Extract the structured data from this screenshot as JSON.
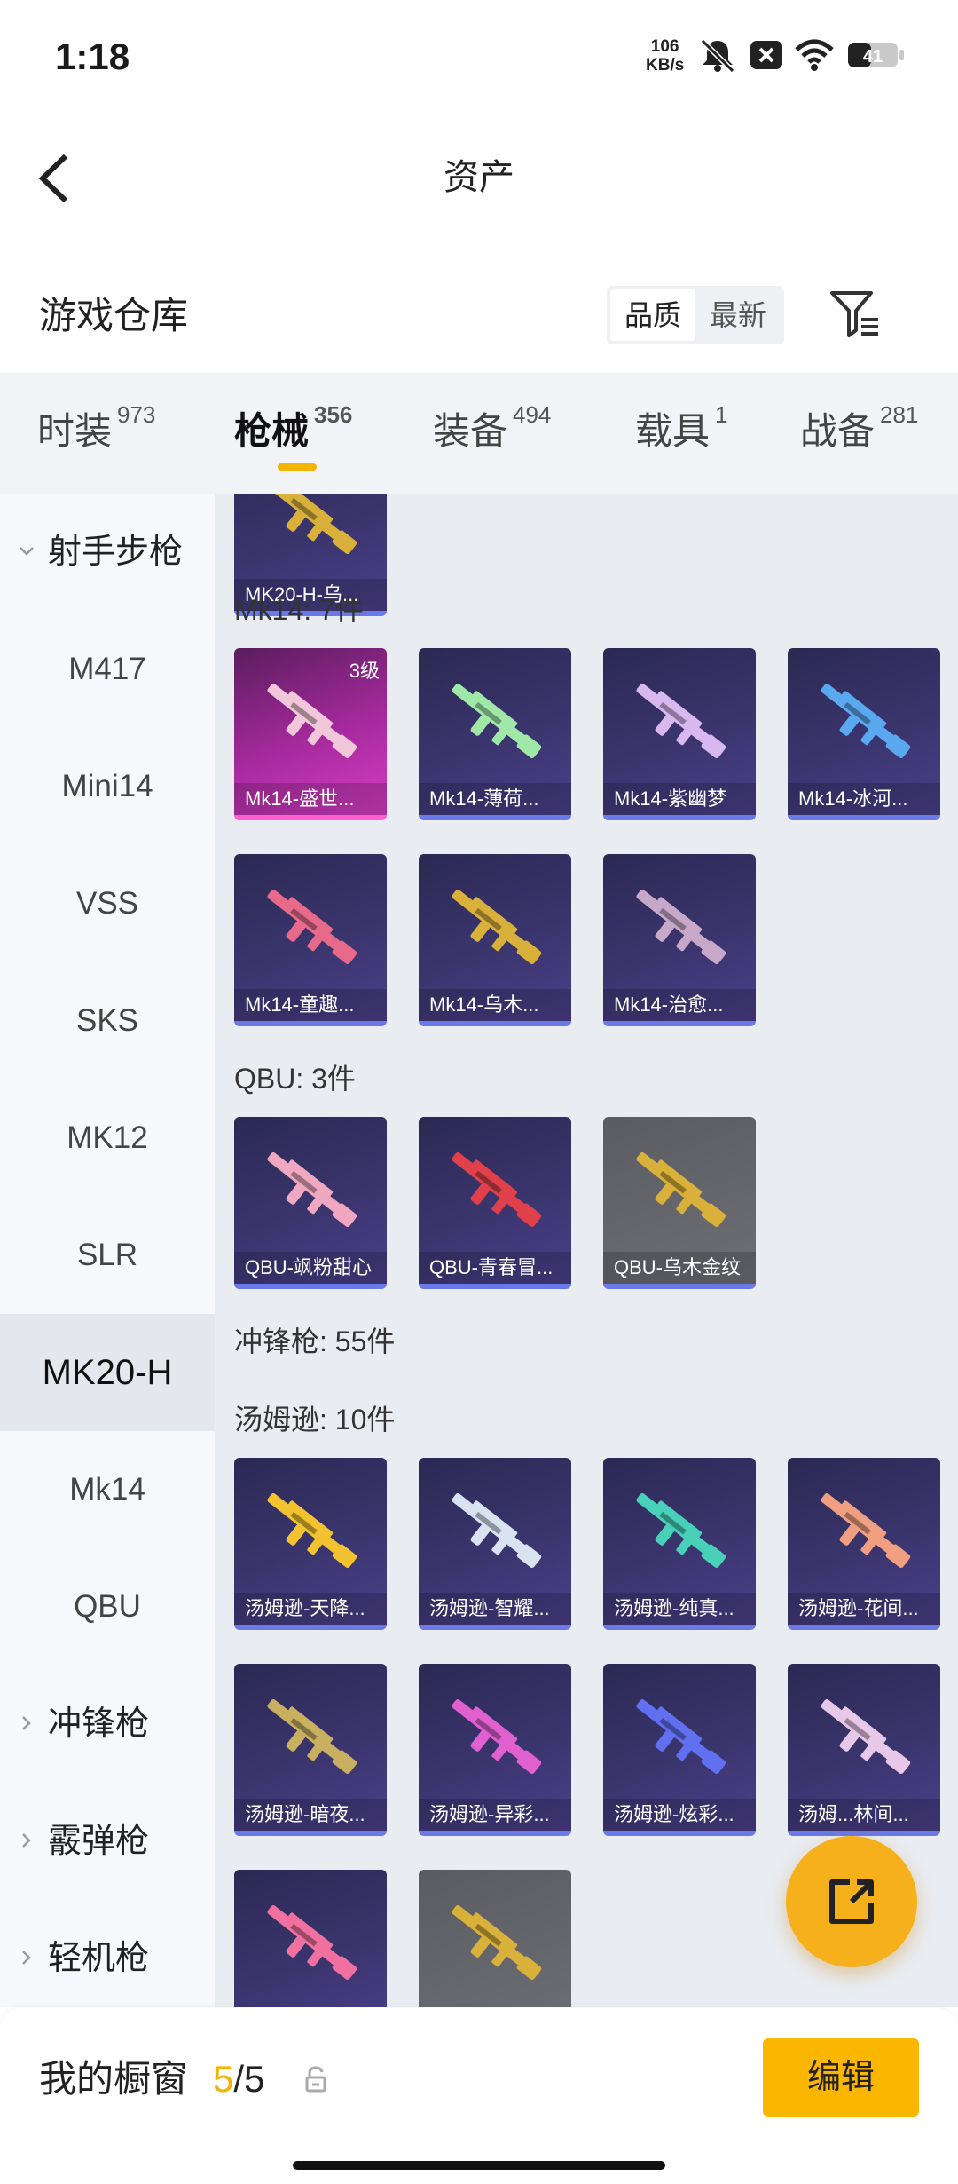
{
  "status_bar": {
    "time": "1:18",
    "net_speed_value": "106",
    "net_speed_unit": "KB/s",
    "battery": "41"
  },
  "nav": {
    "title": "资产"
  },
  "section": {
    "title": "游戏仓库",
    "sort_options": [
      "品质",
      "最新"
    ],
    "sort_selected": "品质"
  },
  "tabs": [
    {
      "label": "时装",
      "count": "973"
    },
    {
      "label": "枪械",
      "count": "356",
      "active": true
    },
    {
      "label": "装备",
      "count": "494"
    },
    {
      "label": "载具",
      "count": "1"
    },
    {
      "label": "战备",
      "count": "281"
    }
  ],
  "sidebar": [
    {
      "label": "射手步枪",
      "type": "group",
      "expanded": true
    },
    {
      "label": "M417"
    },
    {
      "label": "Mini14"
    },
    {
      "label": "VSS"
    },
    {
      "label": "SKS"
    },
    {
      "label": "MK12"
    },
    {
      "label": "SLR"
    },
    {
      "label": "MK20-H",
      "selected": true
    },
    {
      "label": "Mk14"
    },
    {
      "label": "QBU"
    },
    {
      "label": "冲锋枪",
      "type": "group",
      "expanded": false
    },
    {
      "label": "霰弹枪",
      "type": "group",
      "expanded": false
    },
    {
      "label": "轻机枪",
      "type": "group",
      "expanded": false
    }
  ],
  "content": {
    "top_partial_card": {
      "label": "MK20-H-乌...",
      "style": "blue"
    },
    "groups": [
      {
        "heading": "Mk14: 7件",
        "items": [
          {
            "label": "Mk14-盛世...",
            "style": "pink",
            "level": "3级",
            "gun_color": "#f2c7d9"
          },
          {
            "label": "Mk14-薄荷...",
            "style": "blue",
            "gun_color": "#9fe8a8"
          },
          {
            "label": "Mk14-紫幽梦",
            "style": "blue",
            "gun_color": "#d9b8f0"
          },
          {
            "label": "Mk14-冰河...",
            "style": "blue",
            "gun_color": "#5aa8f0"
          },
          {
            "label": "Mk14-童趣...",
            "style": "blue",
            "gun_color": "#e86a8a"
          },
          {
            "label": "Mk14-乌木...",
            "style": "blue",
            "gun_color": "#d9b13a"
          },
          {
            "label": "Mk14-治愈...",
            "style": "blue",
            "gun_color": "#c8a8c8"
          }
        ]
      },
      {
        "heading": "QBU: 3件",
        "items": [
          {
            "label": "QBU-飒粉甜心",
            "style": "blue",
            "gun_color": "#f0a8c0"
          },
          {
            "label": "QBU-青春冒...",
            "style": "blue",
            "gun_color": "#e0404a"
          },
          {
            "label": "QBU-乌木金纹",
            "style": "grey",
            "gun_color": "#d9b13a"
          }
        ]
      },
      {
        "heading": "冲锋枪: 55件",
        "items": []
      },
      {
        "heading": "汤姆逊: 10件",
        "items": [
          {
            "label": "汤姆逊-天降...",
            "style": "blue",
            "gun_color": "#f2c230"
          },
          {
            "label": "汤姆逊-智耀...",
            "style": "blue",
            "gun_color": "#d8e2f0"
          },
          {
            "label": "汤姆逊-纯真...",
            "style": "blue",
            "gun_color": "#48d0b8"
          },
          {
            "label": "汤姆逊-花间...",
            "style": "blue",
            "gun_color": "#f0a080"
          },
          {
            "label": "汤姆逊-暗夜...",
            "style": "blue",
            "gun_color": "#c8b060"
          },
          {
            "label": "汤姆逊-异彩...",
            "style": "blue",
            "gun_color": "#e060d0"
          },
          {
            "label": "汤姆逊-炫彩...",
            "style": "blue",
            "gun_color": "#6070f0"
          },
          {
            "label": "汤姆...林间...",
            "style": "blue",
            "gun_color": "#e8c8e8"
          },
          {
            "label": "",
            "style": "blue",
            "gun_color": "#f070a0"
          },
          {
            "label": "",
            "style": "grey",
            "gun_color": "#d9b13a"
          }
        ]
      }
    ]
  },
  "showcase": {
    "title": "我的橱窗",
    "current": "5",
    "separator": "/",
    "total": "5",
    "edit_label": "编辑"
  },
  "colors": {
    "accent": "#f5b400",
    "fab": "#f6b01c",
    "edit_button": "#fbb700",
    "card_bottom_border": "#6b78e8"
  }
}
